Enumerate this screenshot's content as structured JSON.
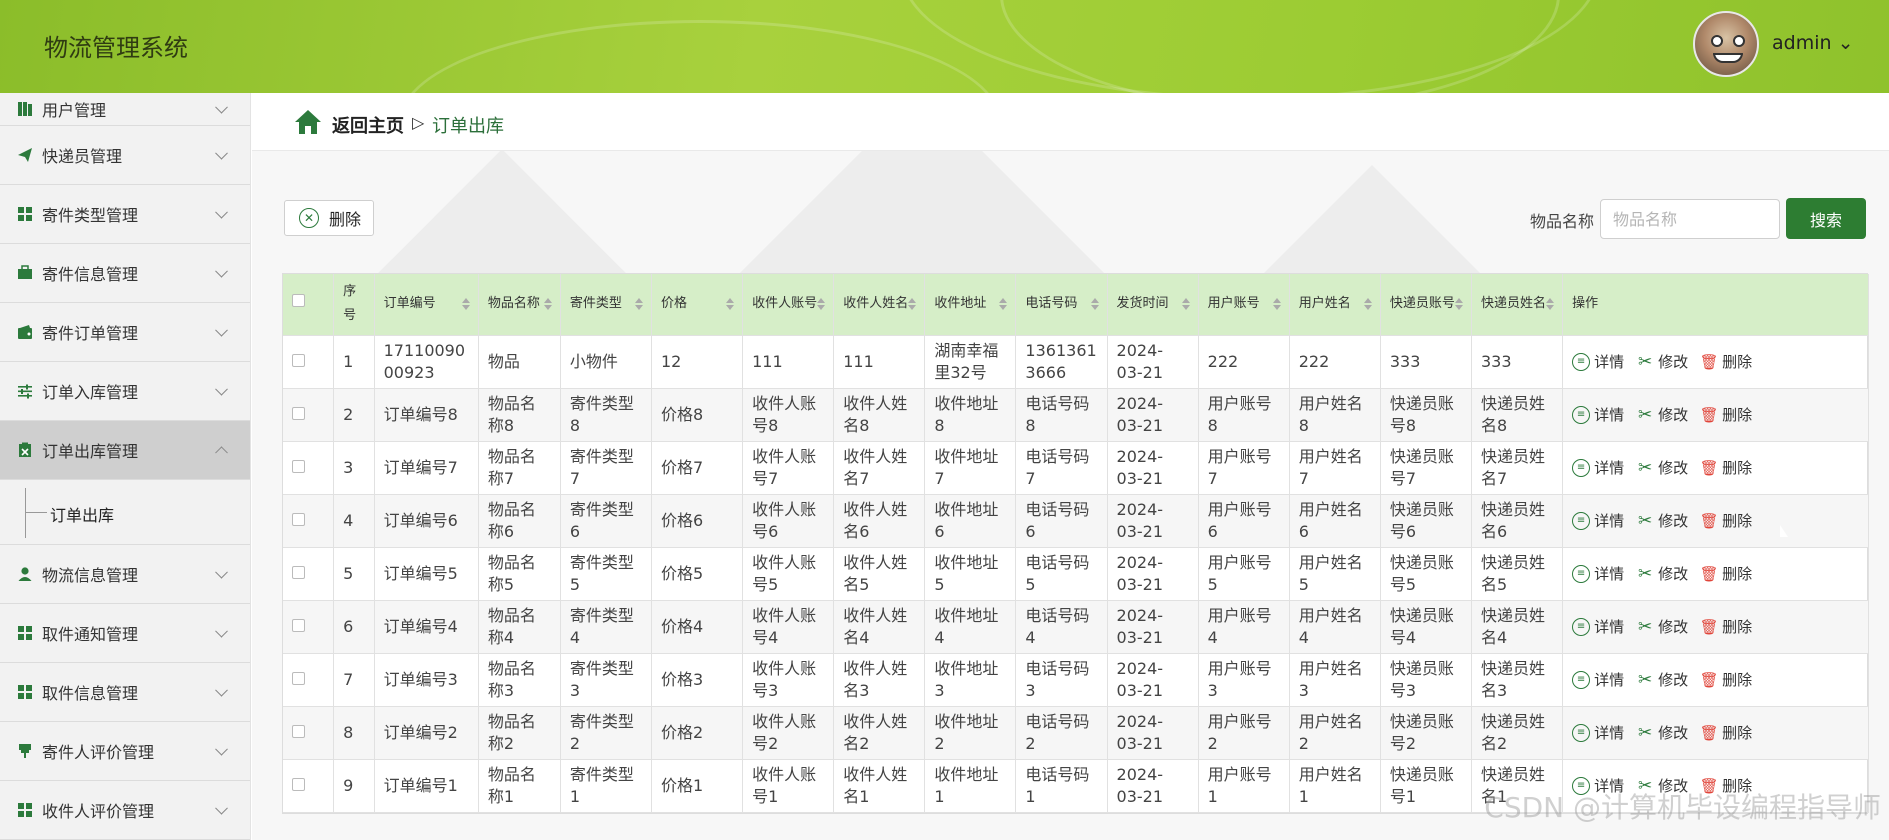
{
  "header": {
    "title": "物流管理系统",
    "user": "admin ⌄"
  },
  "sidebar": {
    "items": [
      {
        "label": "用户管理",
        "icon": "book-icon"
      },
      {
        "label": "快递员管理",
        "icon": "send-icon"
      },
      {
        "label": "寄件类型管理",
        "icon": "grid-icon"
      },
      {
        "label": "寄件信息管理",
        "icon": "briefcase-icon"
      },
      {
        "label": "寄件订单管理",
        "icon": "wallet-icon"
      },
      {
        "label": "订单入库管理",
        "icon": "sliders-icon"
      },
      {
        "label": "订单出库管理",
        "icon": "clipboard-icon"
      },
      {
        "label": "物流信息管理",
        "icon": "user-icon"
      },
      {
        "label": "取件通知管理",
        "icon": "grid-icon"
      },
      {
        "label": "取件信息管理",
        "icon": "grid-icon"
      },
      {
        "label": "寄件人评价管理",
        "icon": "pin-icon"
      },
      {
        "label": "收件人评价管理",
        "icon": "grid-icon"
      }
    ],
    "submenu_label": "订单出库"
  },
  "breadcrumb": {
    "home": "返回主页",
    "separator": "▷",
    "current": "订单出库"
  },
  "toolbar": {
    "delete_label": "删除",
    "search_label": "物品名称",
    "search_placeholder": "物品名称",
    "search_button": "搜索"
  },
  "table": {
    "headers": [
      "序号",
      "订单编号",
      "物品名称",
      "寄件类型",
      "价格",
      "收件人账号",
      "收件人姓名",
      "收件地址",
      "电话号码",
      "发货时间",
      "用户账号",
      "用户姓名",
      "快递员账号",
      "快递员姓名",
      "操作"
    ],
    "rows": [
      [
        "1",
        "17110090 00923",
        "物品",
        "小物件",
        "12",
        "111",
        "111",
        "湖南幸福里32号",
        "1361361 3666",
        "2024-03-21",
        "222",
        "222",
        "333",
        "333"
      ],
      [
        "2",
        "订单编号8",
        "物品名称8",
        "寄件类型8",
        "价格8",
        "收件人账号8",
        "收件人姓名8",
        "收件地址8",
        "电话号码8",
        "2024-03-21",
        "用户账号8",
        "用户姓名8",
        "快递员账号8",
        "快递员姓名8"
      ],
      [
        "3",
        "订单编号7",
        "物品名称7",
        "寄件类型7",
        "价格7",
        "收件人账号7",
        "收件人姓名7",
        "收件地址7",
        "电话号码7",
        "2024-03-21",
        "用户账号7",
        "用户姓名7",
        "快递员账号7",
        "快递员姓名7"
      ],
      [
        "4",
        "订单编号6",
        "物品名称6",
        "寄件类型6",
        "价格6",
        "收件人账号6",
        "收件人姓名6",
        "收件地址6",
        "电话号码6",
        "2024-03-21",
        "用户账号6",
        "用户姓名6",
        "快递员账号6",
        "快递员姓名6"
      ],
      [
        "5",
        "订单编号5",
        "物品名称5",
        "寄件类型5",
        "价格5",
        "收件人账号5",
        "收件人姓名5",
        "收件地址5",
        "电话号码5",
        "2024-03-21",
        "用户账号5",
        "用户姓名5",
        "快递员账号5",
        "快递员姓名5"
      ],
      [
        "6",
        "订单编号4",
        "物品名称4",
        "寄件类型4",
        "价格4",
        "收件人账号4",
        "收件人姓名4",
        "收件地址4",
        "电话号码4",
        "2024-03-21",
        "用户账号4",
        "用户姓名4",
        "快递员账号4",
        "快递员姓名4"
      ],
      [
        "7",
        "订单编号3",
        "物品名称3",
        "寄件类型3",
        "价格3",
        "收件人账号3",
        "收件人姓名3",
        "收件地址3",
        "电话号码3",
        "2024-03-21",
        "用户账号3",
        "用户姓名3",
        "快递员账号3",
        "快递员姓名3"
      ],
      [
        "8",
        "订单编号2",
        "物品名称2",
        "寄件类型2",
        "价格2",
        "收件人账号2",
        "收件人姓名2",
        "收件地址2",
        "电话号码2",
        "2024-03-21",
        "用户账号2",
        "用户姓名2",
        "快递员账号2",
        "快递员姓名2"
      ],
      [
        "9",
        "订单编号1",
        "物品名称1",
        "寄件类型1",
        "价格1",
        "收件人账号1",
        "收件人姓名1",
        "收件地址1",
        "电话号码1",
        "2024-03-21",
        "用户账号1",
        "用户姓名1",
        "快递员账号1",
        "快递员姓名1"
      ]
    ],
    "actions": {
      "detail": "详情",
      "edit": "修改",
      "delete": "删除"
    }
  },
  "watermark": "CSDN @计算机毕设编程指导师"
}
